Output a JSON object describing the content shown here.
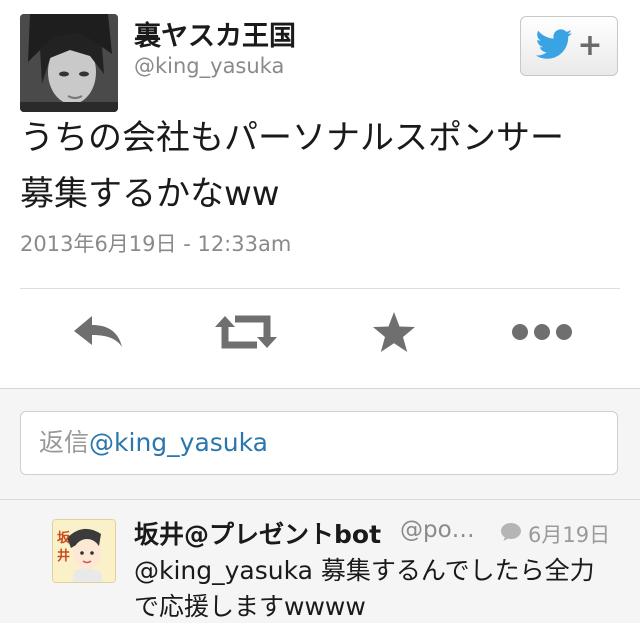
{
  "tweet": {
    "display_name": "裏ヤスカ王国",
    "screen_name": "@king_yasuka",
    "text_line1": "うちの会社もパーソナルスポンサー",
    "text_line2": "募集するかなww",
    "timestamp": "2013年6月19日 - 12:33am"
  },
  "follow_button": {
    "icon": "twitter-bird-icon",
    "symbol": "+"
  },
  "actions": [
    {
      "name": "reply",
      "icon": "reply-arrow-icon"
    },
    {
      "name": "retweet",
      "icon": "retweet-icon"
    },
    {
      "name": "favorite",
      "icon": "star-icon"
    },
    {
      "name": "more",
      "icon": "more-dots-icon"
    }
  ],
  "reply_input": {
    "prefix": "返信",
    "handle": "@king_yasuka"
  },
  "reply_tweet": {
    "display_name": "坂井@プレゼントbot",
    "screen_name": "@po…",
    "date": "6月19日",
    "mention": "@king_yasuka",
    "text": " 募集するんでしたら全力で応援しますwwww"
  },
  "colors": {
    "twitter_blue": "#3aa3e3",
    "icon_gray": "#6f6f6f",
    "link_blue": "#2a76ad"
  }
}
